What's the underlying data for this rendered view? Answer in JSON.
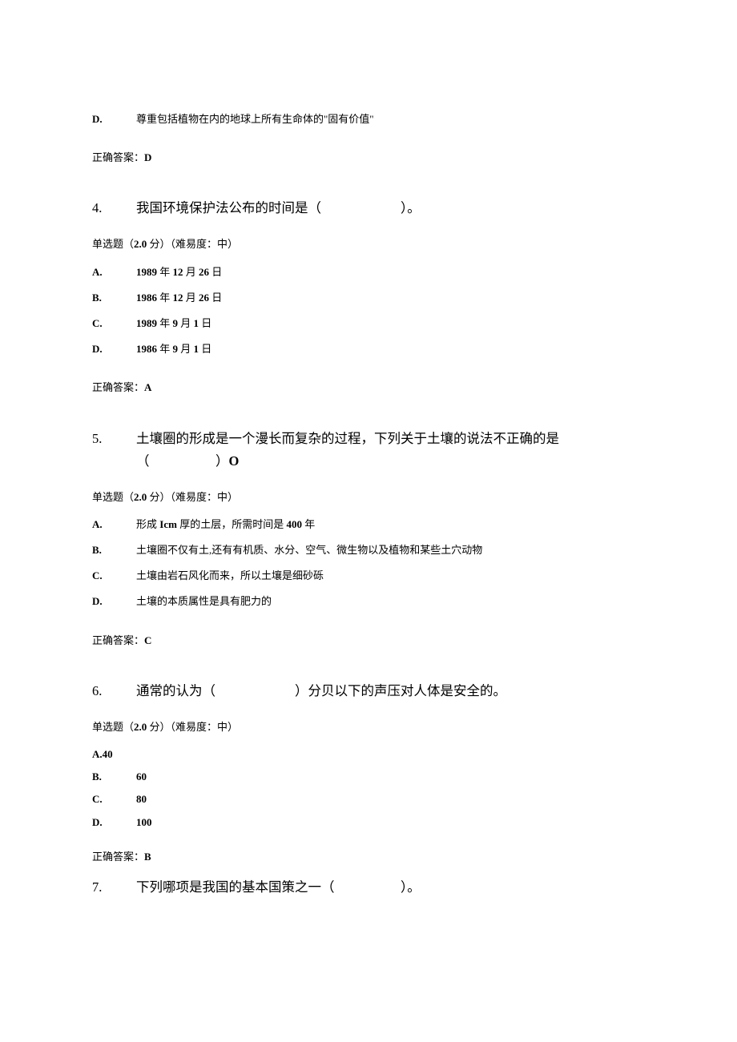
{
  "q3_tail": {
    "option_d_letter": "D.",
    "option_d_text": "尊重包括植物在内的地球上所有生命体的\"固有价值\"",
    "answer_label": "正确答案：",
    "answer_value": "D"
  },
  "q4": {
    "num": "4.",
    "text": "我国环境保护法公布的时间是（　　　　　　）。",
    "meta_prefix": "单选题（",
    "meta_points": "2.0",
    "meta_mid": " 分）（难易度：中）",
    "options": [
      {
        "letter": "A.",
        "pre": "1989",
        "mid1": " 年 ",
        "m": "12",
        "mid2": " 月 ",
        "d": "26",
        "suf": " 日"
      },
      {
        "letter": "B.",
        "pre": "1986",
        "mid1": " 年 ",
        "m": "12",
        "mid2": " 月 ",
        "d": "26",
        "suf": " 日"
      },
      {
        "letter": "C.",
        "pre": "1989",
        "mid1": " 年 ",
        "m": "9",
        "mid2": " 月 ",
        "d": "1",
        "suf": " 日"
      },
      {
        "letter": "D.",
        "pre": "1986",
        "mid1": " 年 ",
        "m": "9",
        "mid2": " 月 ",
        "d": "1",
        "suf": " 日"
      }
    ],
    "answer_label": "正确答案：",
    "answer_value": "A"
  },
  "q5": {
    "num": "5.",
    "text_line1": "土壤圈的形成是一个漫长而复杂的过程，下列关于土壤的说法不正确的是",
    "text_line2_pre": "（　　　　　）",
    "text_line2_suf": "O",
    "meta_prefix": "单选题（",
    "meta_points": "2.0",
    "meta_mid": " 分）（难易度：中）",
    "options": [
      {
        "letter": "A.",
        "text_pre": "形成 ",
        "text_bold": "Icm",
        "text_mid": " 厚的土层，所需时间是 ",
        "text_bold2": "400",
        "text_suf": " 年"
      },
      {
        "letter": "B.",
        "text": "土壤圈不仅有土,还有有机质、水分、空气、微生物以及植物和某些土穴动物"
      },
      {
        "letter": "C.",
        "text": "土壤由岩石风化而来，所以土壤是细砂砾"
      },
      {
        "letter": "D.",
        "text": "土壤的本质属性是具有肥力的"
      }
    ],
    "answer_label": "正确答案：",
    "answer_value": "C"
  },
  "q6": {
    "num": "6.",
    "text": "通常的认为（　　　　　　）分贝以下的声压对人体是安全的。",
    "meta_prefix": "单选题（",
    "meta_points": "2.0",
    "meta_mid": " 分）（难易度：中）",
    "option_a_full": "A.40",
    "options_rest": [
      {
        "letter": "B.",
        "value": "60"
      },
      {
        "letter": "C.",
        "value": "80"
      },
      {
        "letter": "D.",
        "value": "100"
      }
    ],
    "answer_label": "正确答案：",
    "answer_value": "B"
  },
  "q7": {
    "num": "7.",
    "text": "下列哪项是我国的基本国策之一（　　　　　）。"
  }
}
